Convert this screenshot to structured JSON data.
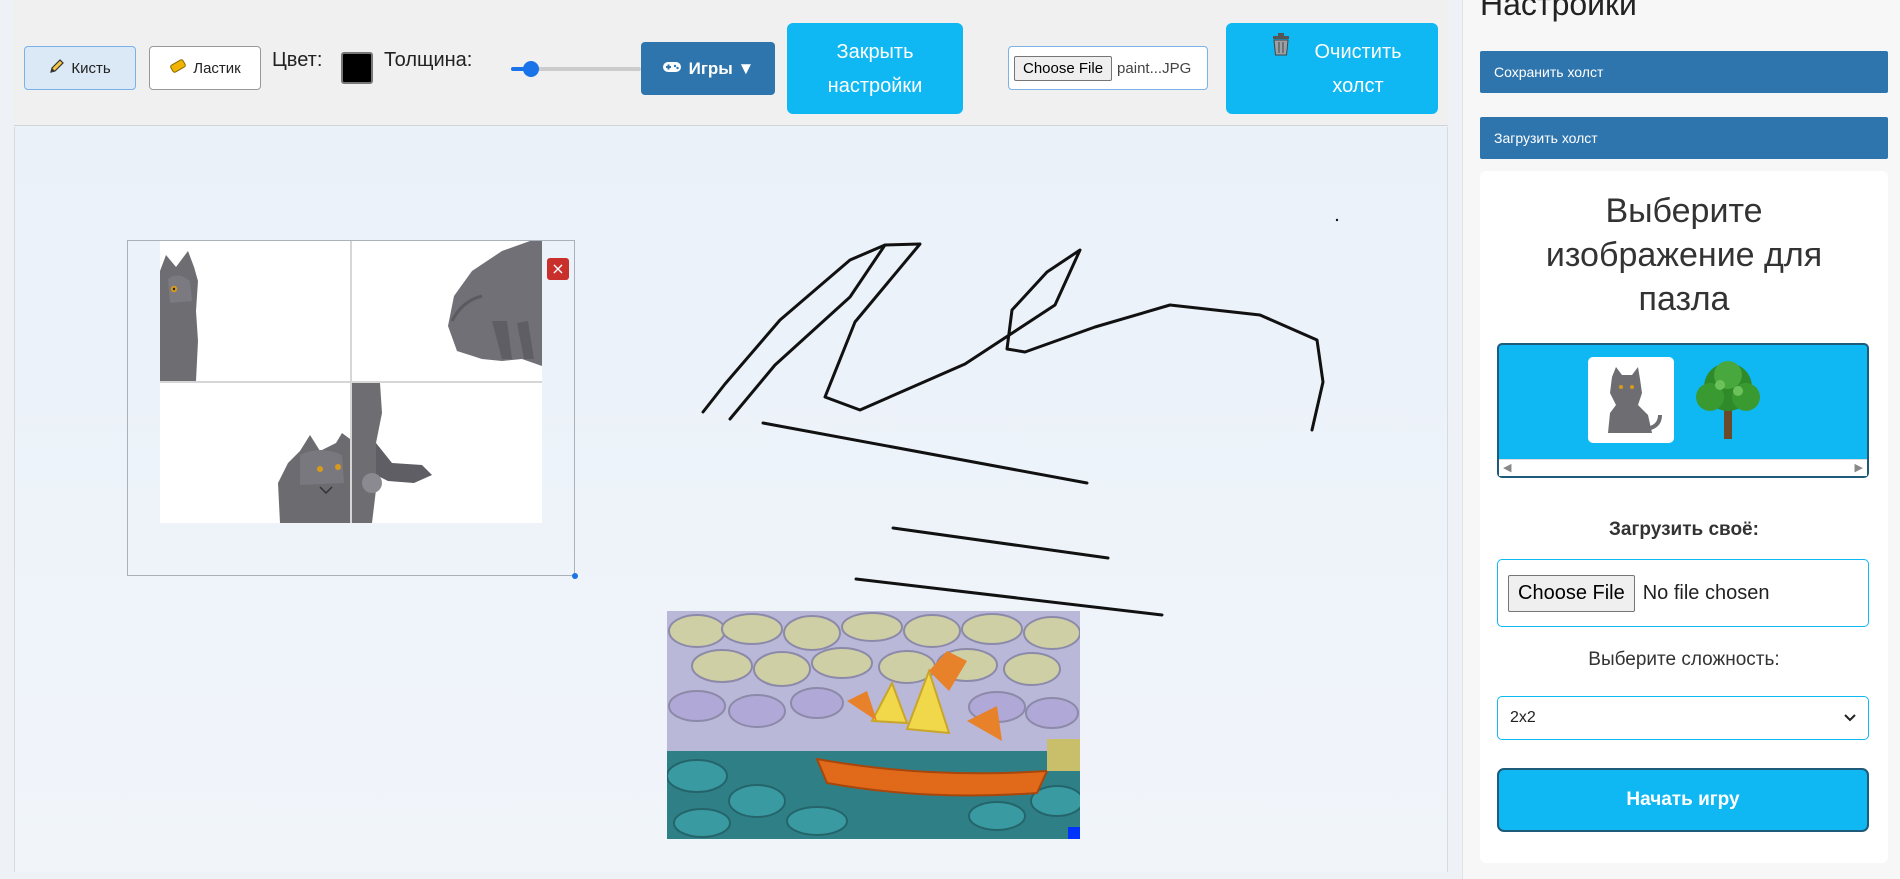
{
  "toolbar": {
    "brush_label": "Кисть",
    "eraser_label": "Ластик",
    "color_label": "Цвет:",
    "thickness_label": "Толщина:",
    "thickness_value_fraction": 0.12,
    "games_label": "Игры ▼",
    "close_settings_label": "Закрыть настройки",
    "file_button": "Choose File",
    "file_name": "paint...JPG",
    "clear_label": "Очистить холст",
    "current_color": "#000000",
    "accent_color": "#0fb8f2",
    "dark_accent": "#2f75ad"
  },
  "canvas": {
    "puzzle_close_icon": "×"
  },
  "settings": {
    "title": "Настройки",
    "save_label": "Сохранить холст",
    "load_label": "Загрузить холст",
    "choose_image_heading": "Выберите изображение для пазла",
    "gallery": [
      "cat",
      "tree"
    ],
    "upload_label": "Загрузить своё:",
    "upload_button": "Choose File",
    "upload_status": "No file chosen",
    "difficulty_label": "Выберите сложность:",
    "difficulty_value": "2x2",
    "start_label": "Начать игру"
  }
}
